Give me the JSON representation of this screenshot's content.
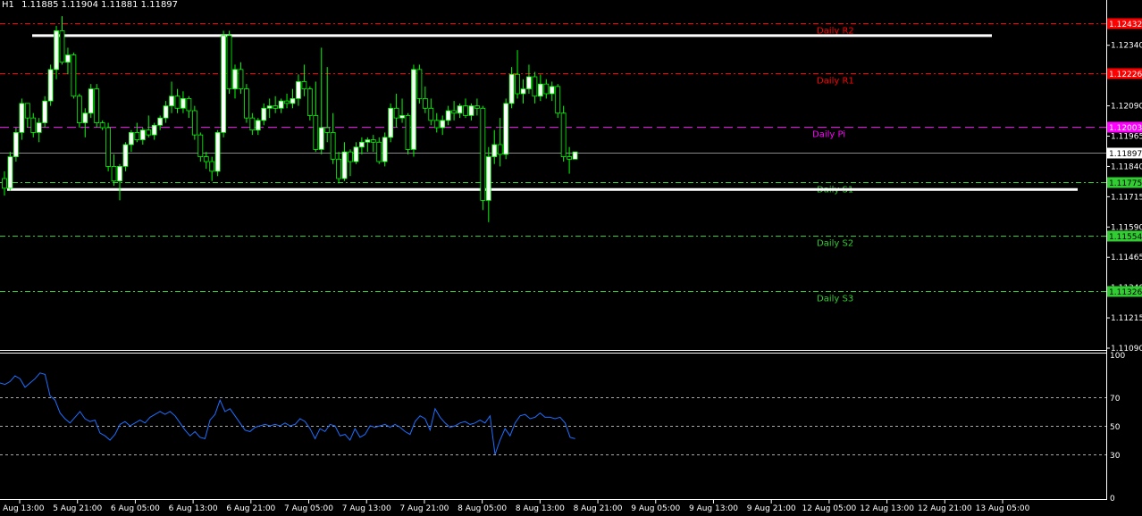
{
  "header": {
    "symbol": "H1",
    "ohlc": "1.11885 1.11904 1.11881 1.11897"
  },
  "colors": {
    "background": "#000000",
    "axis": "#ffffff",
    "candle_up": "#ffffff",
    "candle_down": "#000000",
    "wick": "#00ff00",
    "resistance": "#ff0000",
    "pivot": "#ff00ff",
    "support": "#32cd32",
    "range_lines": "#ffffff",
    "rsi_line": "#1e6fff",
    "level_grid": "#aaaaaa",
    "tag_text_dark": "#000000",
    "tag_text_light": "#ffffff"
  },
  "chart_data": [
    {
      "type": "candlestick",
      "title": "",
      "ylim": [
        1.1109,
        1.1249
      ],
      "y_ticks": [
        "1.12340",
        "1.12215",
        "1.12090",
        "1.11965",
        "1.11840",
        "1.11715",
        "1.11590",
        "1.11465",
        "1.11340",
        "1.11215",
        "1.11090"
      ],
      "x_ticks": [
        "5 Aug 13:00",
        "5 Aug 21:00",
        "6 Aug 05:00",
        "6 Aug 13:00",
        "6 Aug 21:00",
        "7 Aug 05:00",
        "7 Aug 13:00",
        "7 Aug 21:00",
        "8 Aug 05:00",
        "8 Aug 13:00",
        "8 Aug 21:00",
        "9 Aug 05:00",
        "9 Aug 13:00",
        "9 Aug 21:00",
        "12 Aug 05:00",
        "12 Aug 13:00",
        "12 Aug 21:00",
        "13 Aug 05:00"
      ],
      "current_price": "1.11897",
      "levels": [
        {
          "name": "Daily R2",
          "value": 1.12432,
          "tag": "1.12432",
          "kind": "resistance"
        },
        {
          "name": "Daily R1",
          "value": 1.12226,
          "tag": "1.12226",
          "kind": "resistance"
        },
        {
          "name": "Daily Pi",
          "value": 1.12003,
          "tag": "1.12003",
          "kind": "pivot"
        },
        {
          "name": "Daily S1",
          "value": 1.11775,
          "tag": "1.11775",
          "kind": "support"
        },
        {
          "name": "Daily S2",
          "value": 1.11554,
          "tag": "1.11554",
          "kind": "support"
        },
        {
          "name": "Daily S3",
          "value": 1.11326,
          "tag": "1.11326",
          "kind": "support"
        }
      ],
      "range_lines": [
        1.1238,
        1.11745
      ],
      "candles": [
        [
          1.1179,
          1.1182,
          1.1172,
          1.1175
        ],
        [
          1.1175,
          1.119,
          1.1174,
          1.1188
        ],
        [
          1.1188,
          1.12,
          1.1186,
          1.1198
        ],
        [
          1.1198,
          1.1212,
          1.1195,
          1.121
        ],
        [
          1.121,
          1.1207,
          1.12,
          1.1204
        ],
        [
          1.1204,
          1.1206,
          1.1196,
          1.1198
        ],
        [
          1.1198,
          1.1204,
          1.1194,
          1.1202
        ],
        [
          1.1202,
          1.1213,
          1.12,
          1.1211
        ],
        [
          1.1211,
          1.1226,
          1.1209,
          1.1224
        ],
        [
          1.1224,
          1.1242,
          1.122,
          1.124
        ],
        [
          1.124,
          1.1246,
          1.1226,
          1.1227
        ],
        [
          1.1227,
          1.1233,
          1.1222,
          1.123
        ],
        [
          1.123,
          1.1231,
          1.1212,
          1.1213
        ],
        [
          1.1213,
          1.1214,
          1.12,
          1.1202
        ],
        [
          1.1202,
          1.1208,
          1.1196,
          1.1206
        ],
        [
          1.1206,
          1.1218,
          1.1204,
          1.1216
        ],
        [
          1.1216,
          1.1218,
          1.12,
          1.1202
        ],
        [
          1.1202,
          1.1203,
          1.1199,
          1.12
        ],
        [
          1.12,
          1.1202,
          1.1182,
          1.1184
        ],
        [
          1.1184,
          1.1189,
          1.1176,
          1.1178
        ],
        [
          1.1178,
          1.1185,
          1.117,
          1.1184
        ],
        [
          1.1184,
          1.1194,
          1.1182,
          1.1193
        ],
        [
          1.1193,
          1.1199,
          1.119,
          1.1198
        ],
        [
          1.1198,
          1.1202,
          1.1194,
          1.1195
        ],
        [
          1.1195,
          1.12,
          1.1193,
          1.1199
        ],
        [
          1.1199,
          1.1205,
          1.1196,
          1.1197
        ],
        [
          1.1197,
          1.1202,
          1.1195,
          1.1201
        ],
        [
          1.1201,
          1.1205,
          1.1199,
          1.1204
        ],
        [
          1.1204,
          1.1211,
          1.1202,
          1.1209
        ],
        [
          1.1209,
          1.1219,
          1.1206,
          1.1213
        ],
        [
          1.1213,
          1.1216,
          1.1206,
          1.1208
        ],
        [
          1.1208,
          1.1215,
          1.1206,
          1.1212
        ],
        [
          1.1212,
          1.1213,
          1.1204,
          1.1207
        ],
        [
          1.1207,
          1.1209,
          1.1195,
          1.1197
        ],
        [
          1.1197,
          1.1198,
          1.1186,
          1.1188
        ],
        [
          1.1188,
          1.119,
          1.1183,
          1.1186
        ],
        [
          1.1186,
          1.1188,
          1.1178,
          1.1182
        ],
        [
          1.1182,
          1.1199,
          1.118,
          1.1198
        ],
        [
          1.1198,
          1.124,
          1.1196,
          1.1238
        ],
        [
          1.1238,
          1.124,
          1.1214,
          1.1216
        ],
        [
          1.1216,
          1.1226,
          1.1212,
          1.1224
        ],
        [
          1.1224,
          1.1227,
          1.1214,
          1.1216
        ],
        [
          1.1216,
          1.1218,
          1.1202,
          1.1204
        ],
        [
          1.1204,
          1.1206,
          1.1197,
          1.1199
        ],
        [
          1.1199,
          1.1204,
          1.1197,
          1.1203
        ],
        [
          1.1203,
          1.121,
          1.1201,
          1.1208
        ],
        [
          1.1208,
          1.1212,
          1.1204,
          1.1209
        ],
        [
          1.1209,
          1.1213,
          1.1206,
          1.1208
        ],
        [
          1.1208,
          1.1212,
          1.1206,
          1.1211
        ],
        [
          1.1211,
          1.1214,
          1.1208,
          1.121
        ],
        [
          1.121,
          1.1216,
          1.1208,
          1.1212
        ],
        [
          1.1212,
          1.1222,
          1.1209,
          1.1219
        ],
        [
          1.1219,
          1.1226,
          1.1213,
          1.1216
        ],
        [
          1.1216,
          1.1217,
          1.1203,
          1.1205
        ],
        [
          1.1205,
          1.1219,
          1.119,
          1.1191
        ],
        [
          1.1191,
          1.1233,
          1.1189,
          1.12
        ],
        [
          1.12,
          1.1225,
          1.1194,
          1.1198
        ],
        [
          1.1198,
          1.1206,
          1.1185,
          1.1187
        ],
        [
          1.1187,
          1.119,
          1.1177,
          1.1179
        ],
        [
          1.1179,
          1.1194,
          1.1178,
          1.119
        ],
        [
          1.119,
          1.1191,
          1.118,
          1.1186
        ],
        [
          1.1186,
          1.1194,
          1.1185,
          1.1192
        ],
        [
          1.1192,
          1.1196,
          1.1189,
          1.1194
        ],
        [
          1.1194,
          1.1196,
          1.119,
          1.1195
        ],
        [
          1.1195,
          1.1197,
          1.119,
          1.1194
        ],
        [
          1.1194,
          1.1196,
          1.1185,
          1.1186
        ],
        [
          1.1186,
          1.1198,
          1.1184,
          1.1196
        ],
        [
          1.1196,
          1.121,
          1.1194,
          1.1208
        ],
        [
          1.1208,
          1.1214,
          1.12,
          1.1204
        ],
        [
          1.1204,
          1.1212,
          1.1202,
          1.1205
        ],
        [
          1.1205,
          1.1206,
          1.1189,
          1.1191
        ],
        [
          1.1191,
          1.1226,
          1.1188,
          1.1224
        ],
        [
          1.1224,
          1.1226,
          1.121,
          1.1212
        ],
        [
          1.1212,
          1.1217,
          1.1206,
          1.1208
        ],
        [
          1.1208,
          1.1212,
          1.1201,
          1.1203
        ],
        [
          1.1203,
          1.1206,
          1.1198,
          1.12
        ],
        [
          1.12,
          1.1205,
          1.1197,
          1.1203
        ],
        [
          1.1203,
          1.1209,
          1.1201,
          1.1207
        ],
        [
          1.1207,
          1.1211,
          1.1203,
          1.1206
        ],
        [
          1.1206,
          1.121,
          1.1204,
          1.1209
        ],
        [
          1.1209,
          1.1212,
          1.1204,
          1.1205
        ],
        [
          1.1205,
          1.121,
          1.1203,
          1.1209
        ],
        [
          1.1209,
          1.1212,
          1.1205,
          1.1208
        ],
        [
          1.1208,
          1.1209,
          1.1166,
          1.117
        ],
        [
          1.117,
          1.1192,
          1.1161,
          1.1188
        ],
        [
          1.1188,
          1.1199,
          1.1185,
          1.1193
        ],
        [
          1.1193,
          1.1204,
          1.1184,
          1.1189
        ],
        [
          1.1189,
          1.1212,
          1.1187,
          1.121
        ],
        [
          1.121,
          1.1225,
          1.1208,
          1.1222
        ],
        [
          1.1222,
          1.1232,
          1.1212,
          1.1214
        ],
        [
          1.1214,
          1.122,
          1.121,
          1.1216
        ],
        [
          1.1216,
          1.1226,
          1.1214,
          1.1221
        ],
        [
          1.1221,
          1.1223,
          1.121,
          1.1213
        ],
        [
          1.1213,
          1.1222,
          1.1211,
          1.1218
        ],
        [
          1.1218,
          1.122,
          1.1212,
          1.1214
        ],
        [
          1.1214,
          1.1219,
          1.1211,
          1.1217
        ],
        [
          1.1217,
          1.1218,
          1.1204,
          1.1206
        ],
        [
          1.1206,
          1.1209,
          1.1186,
          1.1188
        ],
        [
          1.1188,
          1.1192,
          1.1181,
          1.1187
        ],
        [
          1.1187,
          1.119,
          1.1188,
          1.119
        ]
      ]
    },
    {
      "type": "line",
      "title": "",
      "ylim": [
        0,
        100
      ],
      "y_ticks": [
        "100",
        "70",
        "50",
        "30",
        "0"
      ],
      "levels": [
        70,
        50,
        30
      ],
      "series": [
        {
          "values": [
            80,
            79,
            81,
            85,
            83,
            77,
            80,
            83,
            87,
            86,
            71,
            68,
            59,
            55,
            52,
            56,
            60,
            55,
            53,
            54,
            45,
            43,
            40,
            44,
            51,
            53,
            50,
            52,
            54,
            52,
            56,
            58,
            60,
            58,
            60,
            57,
            52,
            47,
            43,
            46,
            42,
            41,
            54,
            58,
            68,
            60,
            62,
            57,
            52,
            47,
            46,
            49,
            50,
            51,
            50,
            51,
            50,
            52,
            50,
            51,
            55,
            53,
            48,
            41,
            48,
            46,
            51,
            50,
            43,
            44,
            40,
            48,
            42,
            44,
            50,
            49,
            50,
            51,
            49,
            51,
            49,
            46,
            44,
            53,
            57,
            55,
            47,
            62,
            56,
            52,
            49,
            50,
            52,
            53,
            51,
            52,
            54,
            52,
            57,
            30,
            40,
            48,
            43,
            52,
            57,
            58,
            55,
            56,
            59,
            56,
            56,
            55,
            56,
            52,
            42,
            41
          ]
        }
      ]
    }
  ]
}
